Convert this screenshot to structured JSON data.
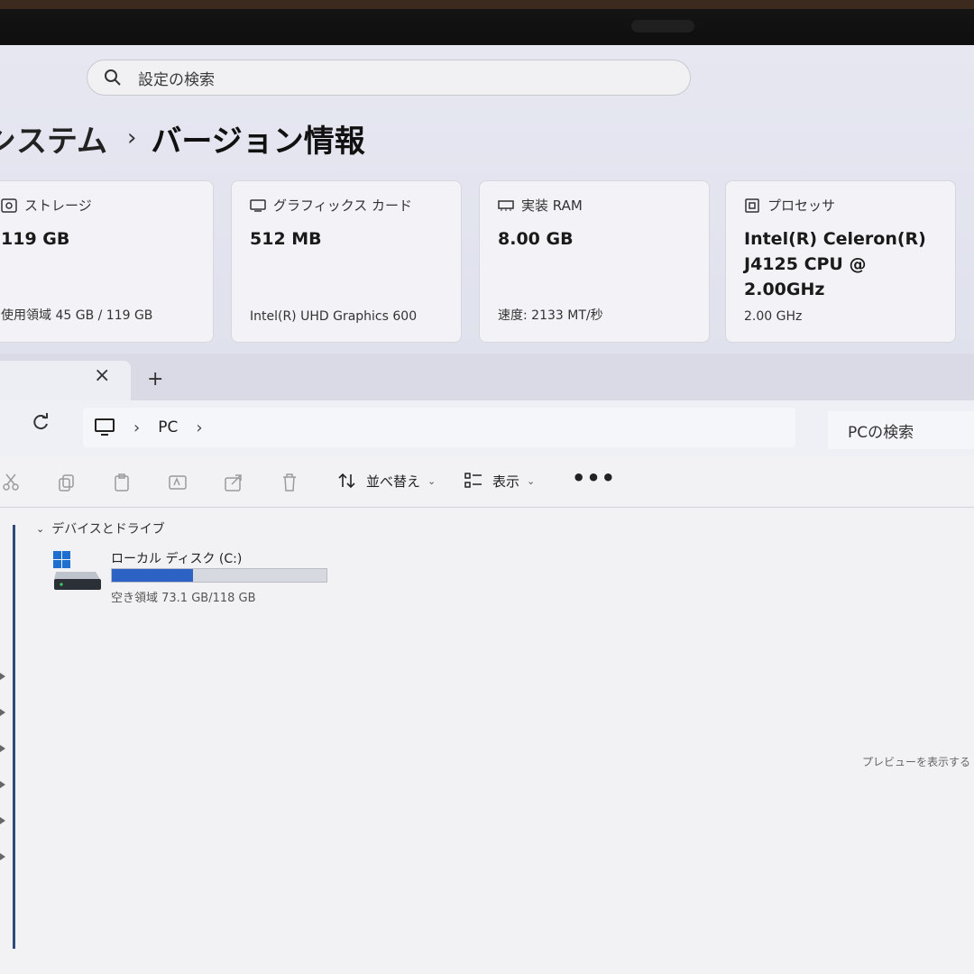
{
  "settings": {
    "search": {
      "placeholder": "設定の検索"
    },
    "breadcrumb": {
      "parent": "システム",
      "separator": "›",
      "current": "バージョン情報"
    },
    "cards": [
      {
        "title": "ストレージ",
        "value": "119 GB",
        "sub": "使用領域 45 GB / 119 GB",
        "icon": "storage-icon"
      },
      {
        "title": "グラフィックス カード",
        "value": "512 MB",
        "sub": "Intel(R) UHD Graphics 600",
        "icon": "graphics-card-icon"
      },
      {
        "title": "実装 RAM",
        "value": "8.00 GB",
        "sub": "速度: 2133 MT/秒",
        "icon": "ram-icon"
      },
      {
        "title": "プロセッサ",
        "value": "Intel(R) Celeron(R) J4125 CPU @ 2.00GHz",
        "sub": "2.00 GHz",
        "icon": "processor-icon"
      }
    ]
  },
  "explorer": {
    "tab": {
      "close": "×",
      "new": "+"
    },
    "address": {
      "location": "PC",
      "chevron": "›"
    },
    "search_placeholder": "PCの検索",
    "toolbar": {
      "sort": "並べ替え",
      "view": "表示",
      "more": "•••",
      "caret": "⌄"
    },
    "group": {
      "chevron": "⌄",
      "label": "デバイスとドライブ"
    },
    "drive": {
      "name": "ローカル ディスク (C:)",
      "free": "空き領域 73.1 GB/118 GB",
      "used_fraction": 0.38
    },
    "preview_text": "プレビューを表示する ア"
  },
  "colors": {
    "accent": "#2c62c4",
    "background": "#f2f2f4"
  }
}
